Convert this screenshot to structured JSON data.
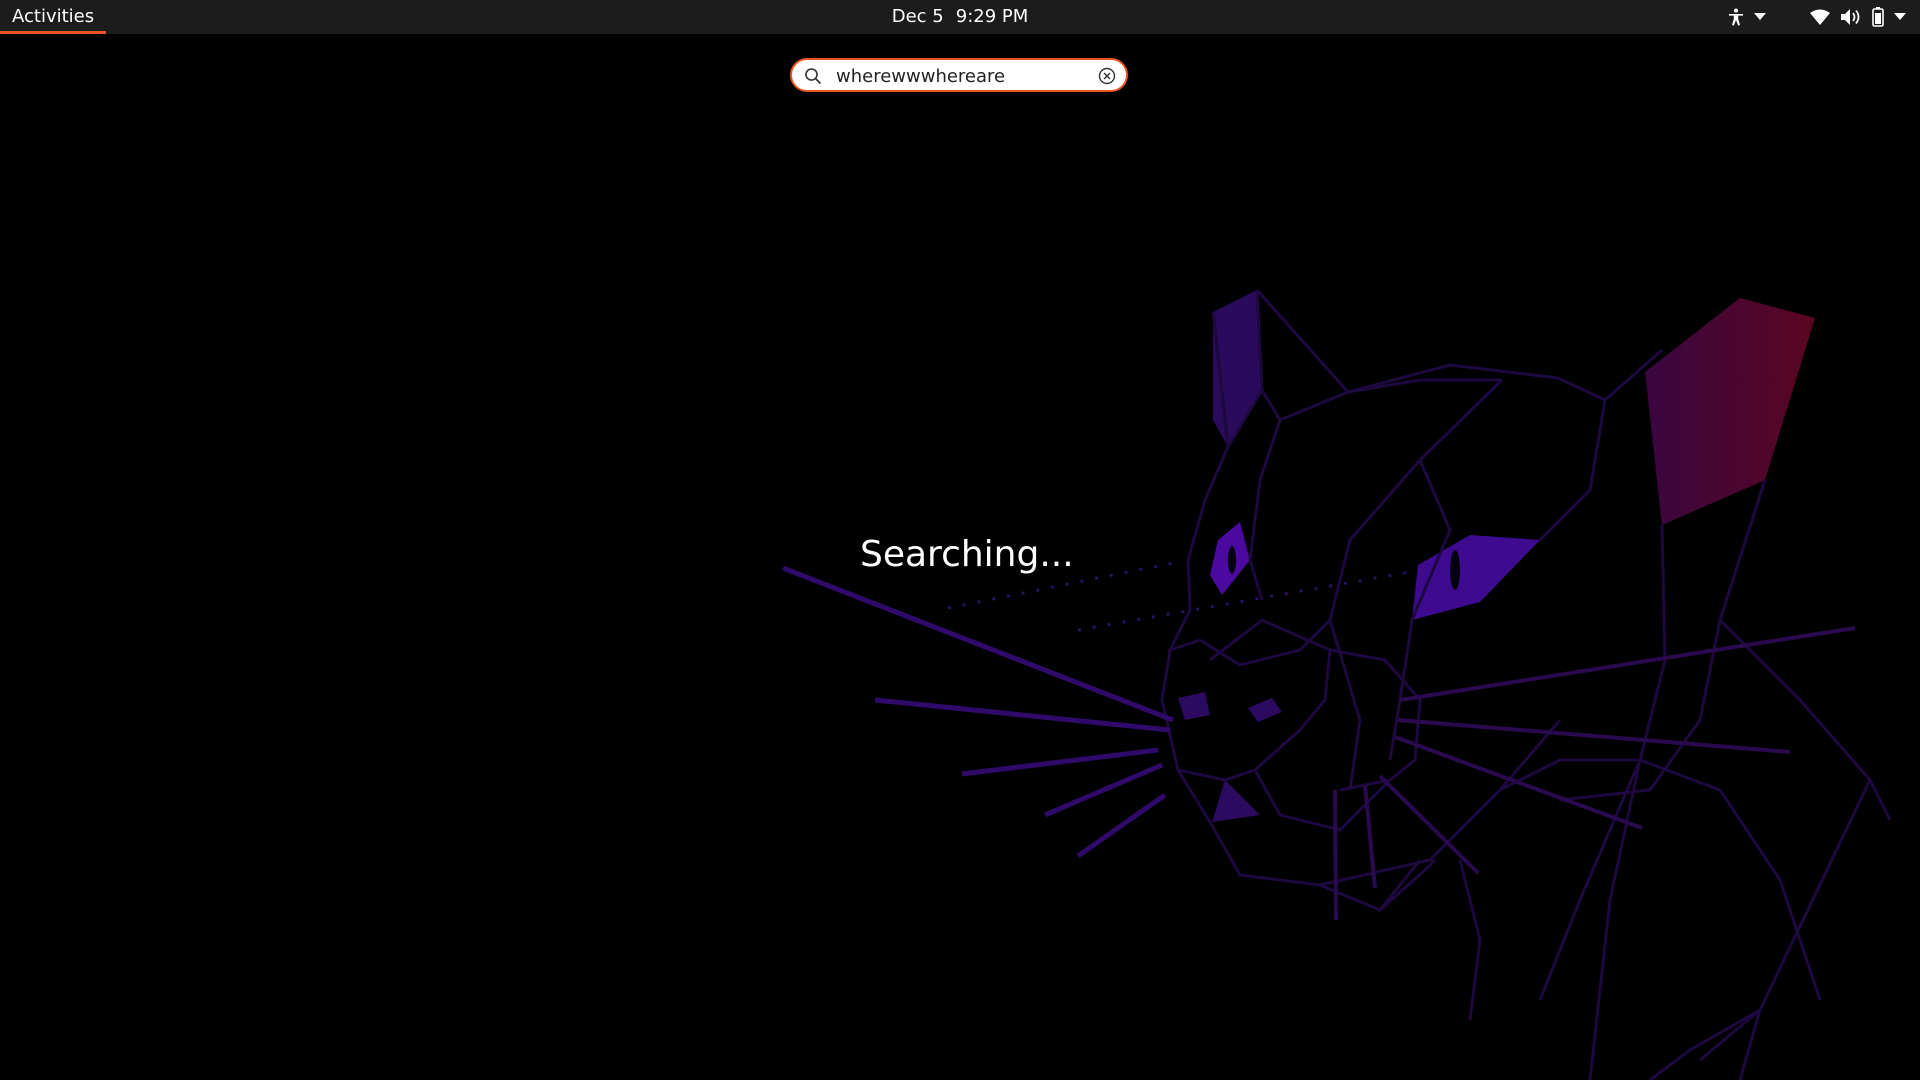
{
  "topbar": {
    "activities_label": "Activities",
    "date": "Dec 5",
    "time": "9:29 PM",
    "tray_icons": [
      "accessibility-icon",
      "chevron-down-icon",
      "wifi-icon",
      "volume-icon",
      "battery-icon",
      "chevron-down-icon"
    ]
  },
  "search": {
    "value": "wherewwwhereare",
    "icon": "search-icon",
    "clear_icon": "clear-icon"
  },
  "status": {
    "text": "Searching..."
  },
  "colors": {
    "accent": "#e95420",
    "topbar_bg": "#1c1c1c",
    "background": "#000000",
    "wallpaper_purple": "#4b0aa0",
    "wallpaper_red": "#6a0a2a"
  }
}
